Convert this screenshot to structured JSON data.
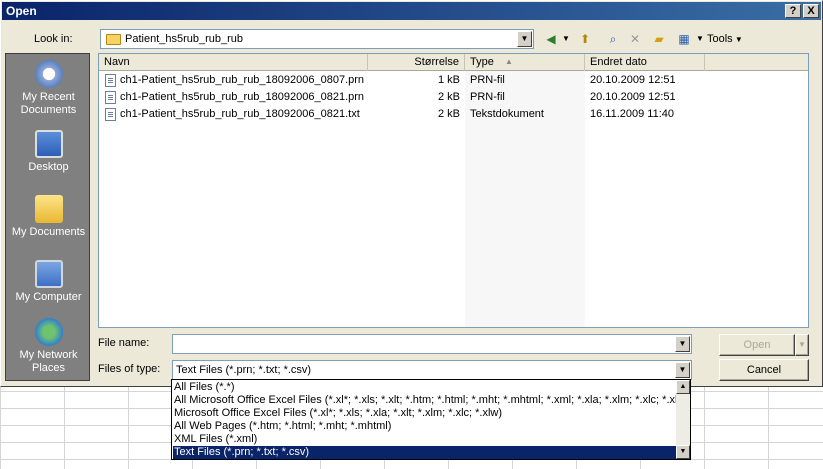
{
  "window": {
    "title": "Open",
    "help_label": "?",
    "close_label": "X"
  },
  "lookin": {
    "label": "Look in:",
    "value": "Patient_hs5rub_rub_rub"
  },
  "toolbar": {
    "tools_label": "Tools"
  },
  "places": [
    {
      "label": "My Recent Documents",
      "icon": "recent-documents-icon"
    },
    {
      "label": "Desktop",
      "icon": "desktop-icon"
    },
    {
      "label": "My Documents",
      "icon": "my-documents-icon"
    },
    {
      "label": "My Computer",
      "icon": "my-computer-icon"
    },
    {
      "label": "My Network Places",
      "icon": "network-places-icon"
    }
  ],
  "columns": {
    "name": "Navn",
    "size": "Størrelse",
    "type": "Type",
    "date": "Endret dato"
  },
  "files": [
    {
      "name": "ch1-Patient_hs5rub_rub_rub_18092006_0807.prn",
      "size": "1 kB",
      "type": "PRN-fil",
      "date": "20.10.2009 12:51"
    },
    {
      "name": "ch1-Patient_hs5rub_rub_rub_18092006_0821.prn",
      "size": "2 kB",
      "type": "PRN-fil",
      "date": "20.10.2009 12:51"
    },
    {
      "name": "ch1-Patient_hs5rub_rub_rub_18092006_0821.txt",
      "size": "2 kB",
      "type": "Tekstdokument",
      "date": "16.11.2009 11:40"
    }
  ],
  "filename": {
    "label": "File name:",
    "value": ""
  },
  "filetype": {
    "label": "Files of type:",
    "value": "Text Files (*.prn; *.txt; *.csv)"
  },
  "buttons": {
    "open": "Open",
    "cancel": "Cancel"
  },
  "filetype_options": [
    "All Files (*.*)",
    "All Microsoft Office Excel Files (*.xl*; *.xls; *.xlt; *.htm; *.html; *.mht; *.mhtml; *.xml; *.xla; *.xlm; *.xlc; *.xlw)",
    "Microsoft Office Excel Files (*.xl*; *.xls; *.xla; *.xlt; *.xlm; *.xlc; *.xlw)",
    "All Web Pages (*.htm; *.html; *.mht; *.mhtml)",
    "XML Files (*.xml)",
    "Text Files (*.prn; *.txt; *.csv)"
  ],
  "selected_option_index": 5
}
